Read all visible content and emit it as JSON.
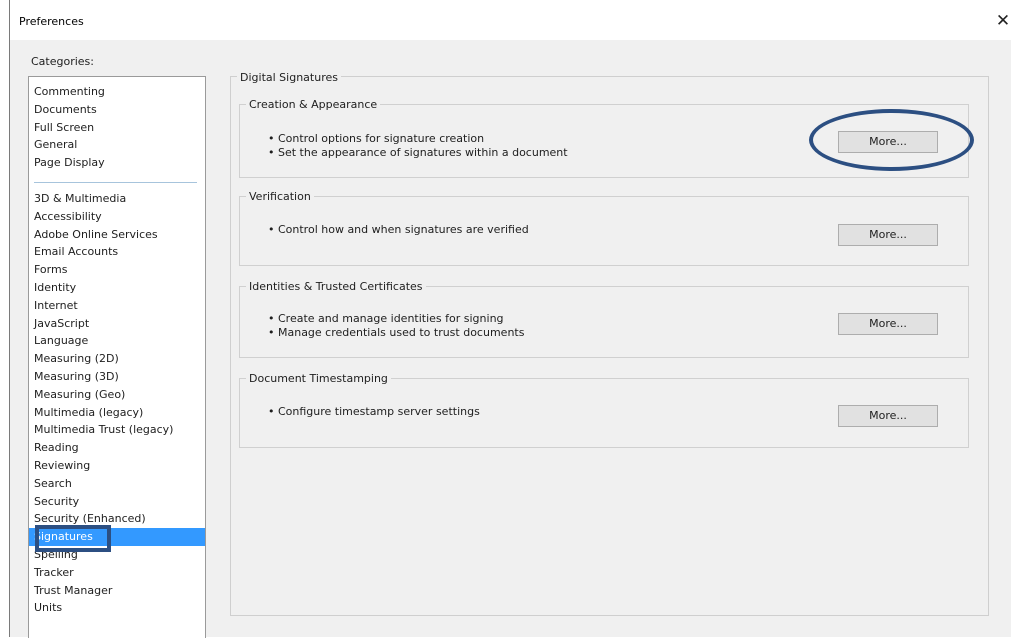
{
  "window": {
    "title": "Preferences",
    "close_glyph": "✕"
  },
  "categories": {
    "label": "Categories:",
    "group1": [
      "Commenting",
      "Documents",
      "Full Screen",
      "General",
      "Page Display"
    ],
    "group2": [
      "3D & Multimedia",
      "Accessibility",
      "Adobe Online Services",
      "Email Accounts",
      "Forms",
      "Identity",
      "Internet",
      "JavaScript",
      "Language",
      "Measuring (2D)",
      "Measuring (3D)",
      "Measuring (Geo)",
      "Multimedia (legacy)",
      "Multimedia Trust (legacy)",
      "Reading",
      "Reviewing",
      "Search",
      "Security",
      "Security (Enhanced)",
      "Signatures",
      "Spelling",
      "Tracker",
      "Trust Manager",
      "Units"
    ],
    "selected": "Signatures"
  },
  "panel": {
    "title": "Digital Signatures",
    "groups": [
      {
        "title": "Creation & Appearance",
        "lines": [
          "• Control options for signature creation",
          "• Set the appearance of signatures within a document"
        ],
        "button": "More..."
      },
      {
        "title": "Verification",
        "lines": [
          "• Control how and when signatures are verified"
        ],
        "button": "More..."
      },
      {
        "title": "Identities & Trusted Certificates",
        "lines": [
          "• Create and manage identities for signing",
          "• Manage credentials used to trust documents"
        ],
        "button": "More..."
      },
      {
        "title": "Document Timestamping",
        "lines": [
          "• Configure timestamp server settings"
        ],
        "button": "More..."
      }
    ]
  },
  "colors": {
    "selection": "#3399ff",
    "annotation": "#2c4f82"
  }
}
